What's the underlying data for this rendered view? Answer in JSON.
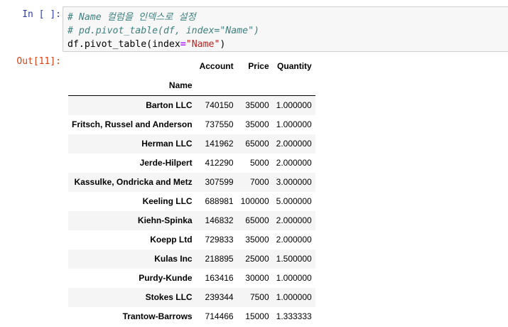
{
  "input_prompt": "In [ ]:",
  "output_prompt": "Out[11]:",
  "code": {
    "line1": "# Name 컬럼을 인덱스로 설정",
    "line2": "# pd.pivot_table(df, index=\"Name\")",
    "line3_a": "df.pivot_table(index",
    "line3_eq": "=",
    "line3_str": "\"Name\"",
    "line3_b": ")"
  },
  "table": {
    "index_name": "Name",
    "columns": [
      "Account",
      "Price",
      "Quantity"
    ],
    "rows": [
      {
        "name": "Barton LLC",
        "account": "740150",
        "price": "35000",
        "quantity": "1.000000"
      },
      {
        "name": "Fritsch, Russel and Anderson",
        "account": "737550",
        "price": "35000",
        "quantity": "1.000000"
      },
      {
        "name": "Herman LLC",
        "account": "141962",
        "price": "65000",
        "quantity": "2.000000"
      },
      {
        "name": "Jerde-Hilpert",
        "account": "412290",
        "price": "5000",
        "quantity": "2.000000"
      },
      {
        "name": "Kassulke, Ondricka and Metz",
        "account": "307599",
        "price": "7000",
        "quantity": "3.000000"
      },
      {
        "name": "Keeling LLC",
        "account": "688981",
        "price": "100000",
        "quantity": "5.000000"
      },
      {
        "name": "Kiehn-Spinka",
        "account": "146832",
        "price": "65000",
        "quantity": "2.000000"
      },
      {
        "name": "Koepp Ltd",
        "account": "729833",
        "price": "35000",
        "quantity": "2.000000"
      },
      {
        "name": "Kulas Inc",
        "account": "218895",
        "price": "25000",
        "quantity": "1.500000"
      },
      {
        "name": "Purdy-Kunde",
        "account": "163416",
        "price": "30000",
        "quantity": "1.000000"
      },
      {
        "name": "Stokes LLC",
        "account": "239344",
        "price": "7500",
        "quantity": "1.000000"
      },
      {
        "name": "Trantow-Barrows",
        "account": "714466",
        "price": "15000",
        "quantity": "1.333333"
      }
    ]
  }
}
